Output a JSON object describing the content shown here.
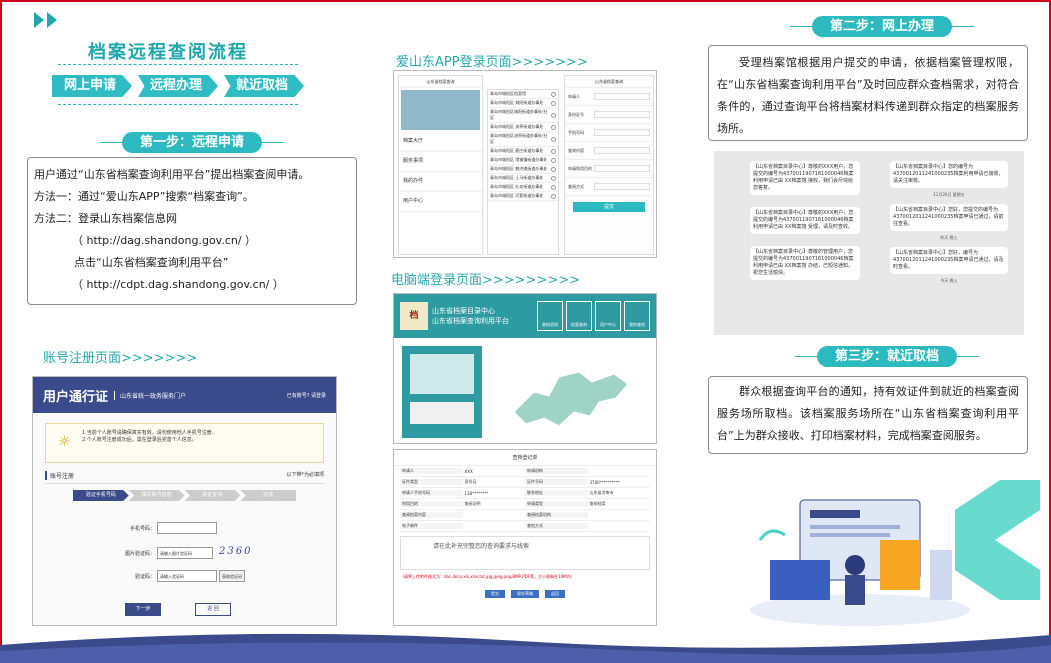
{
  "colors": {
    "accent": "#2cb9bf",
    "border": "#d0021b",
    "navy": "#3a4a8a"
  },
  "left": {
    "title": "档案远程查阅流程",
    "flow": [
      "网上申请",
      "远程办理",
      "就近取档"
    ],
    "step1": "第一步：远程申请",
    "step1_lines": [
      "用户通过“山东省档案查询利用平台”提出档案查阅申请。",
      "方法一：通过“爱山东APP”搜索“档案查询”。",
      "方法二：登录山东档案信息网",
      "（ http://dag.shandong.gov.cn/ ）",
      "点击“山东省档案查询利用平台”",
      "（ http://cdpt.dag.shandong.gov.cn/ ）"
    ],
    "reg_label": "账号注册页面>>>>>>>"
  },
  "reg": {
    "header_title": "用户通行证",
    "header_sub": "山东省统一政务服务门户",
    "header_right": "已有账号? 请登录",
    "notice1": "1.当前个人账号请确保真实有效，请勿使用他人手机号注册。",
    "notice2": "2.个人账号注册成功后，需在登录后完善个人信息。",
    "tab_left": "账号注册",
    "tab_right": "以下带*为必填项",
    "steps": [
      "验证手机号码",
      "填写账号信息",
      "验证证书",
      "完成"
    ],
    "f_phone": "手机号码：",
    "f_captcha": "图片验证码：",
    "f_captcha_ph": "请输入图片验证码",
    "captcha": "2360",
    "f_code": "验证码：",
    "f_code_ph": "请输入验证码",
    "get_code": "获取验证码",
    "next": "下一步",
    "back": "返 回"
  },
  "mid": {
    "app_label": "爱山东APP登录页面>>>>>>>",
    "pc_label": "电脑端登录页面>>>>>>>>>",
    "app_header": "山东省档案查询",
    "app_form_title": "山东省档案查询",
    "app_menu": [
      "档案大厅",
      "服务事项",
      "我的办件",
      "用户中心"
    ],
    "districts": [
      "青岛市城阳区档案馆",
      "青岛市城阳区 城阳街道办事处",
      "青岛市城阳区城阳街道办事处/社区",
      "青岛市城阳区 流亭街道办事处",
      "青岛市城阳区流亭街道办事处/社区",
      "青岛市城阳区 夏庄街道办事处",
      "青岛市城阳区 惜福镇街道办事处",
      "青岛市城阳区 棘洪滩街道办事处",
      "青岛市城阳区 上马街道办事处",
      "青岛市城阳区 红岛街道办事处",
      "青岛市城阳区 河套街道办事处"
    ],
    "app_fields": [
      "申请人",
      "身份证号",
      "手机号码",
      "查询内容",
      "申请利用目的",
      "查阅方式"
    ],
    "app_submit": "提交",
    "pc_title1": "山东省档案目录中心",
    "pc_title2": "山东省档案查询利用平台",
    "pc_nav": [
      "查档须知",
      "档案查询",
      "用户中心",
      "我的查档"
    ],
    "form_title": "查档登记单",
    "form_rows": [
      [
        "申请人",
        "XXX",
        "申请机构",
        ""
      ],
      [
        "证件类型",
        "身份证",
        "证件号码",
        "3700**********"
      ],
      [
        "申请人手机号码",
        "138********",
        "联系地址",
        "山东省济南市"
      ],
      [
        "利用目的",
        "查阅证明",
        "申请类型",
        "查阅档案"
      ],
      [
        "查阅档案内容",
        "",
        "查阅档案机构",
        ""
      ],
      [
        "电子邮件",
        "",
        "查档方式",
        ""
      ]
    ],
    "form_hint": "请在此补充完整您的查询要求与线索",
    "form_warn": "（请将上传附件格式为：doc,docx,xls,xlsx,txt,jpg,jpeg,png,BMP,PDF等，大小限制在10M内）",
    "form_btns": [
      "提交",
      "保存草稿",
      "返回"
    ]
  },
  "right": {
    "step2": "第二步：网上办理",
    "step2_text": "受理档案馆根据用户提交的申请，依据档案管理权限，在“山东省档案查询利用平台”及时回应群众查档需求，对符合条件的，通过查询平台将档案材料传递到群众指定的档案服务场所。",
    "step3": "第三步：就近取档",
    "step3_text": "群众根据查询平台的通知，持有效证件到就近的档案查阅服务场所取档。该档案服务场所在“山东省档案查询利用平台”上为群众接收、打印档案材料，完成档案查阅服务。",
    "sms_left": [
      "【山东省档案目录中心】尊敬的XXX用户，您提交的编号为4370011907161000046档案利用申请已由 XX档案馆 接收，我们会尽快给您答复。",
      "【山东省档案目录中心】尊敬的XXX用户，您提交的编号为4370011907161000046档案利用申请已由 XX档案馆 受理，请及时查收。",
      "【山东省档案目录中心】尊敬的管理用户，您提交的编号为4370011907161000046档案利用申请已由 XX档案馆 办结，已短信通知，祝您生活愉快。"
    ],
    "sms_right": [
      "【山东省档案目录中心】您的编号为4370012011241000235档案利用申请已接收，请关注审核。",
      "【山东省档案目录中心】您好，您提交的编号为4370012011241000235档案申请已通过，请前往查看。",
      "【山东省档案目录中心】您好，编号为4370012011241000235档案申请已通过，请及时查看。"
    ],
    "sms_date": "11月26日 星期五",
    "sms_tag1": "昨天 晚上",
    "sms_tag2": "今天 晚上"
  }
}
